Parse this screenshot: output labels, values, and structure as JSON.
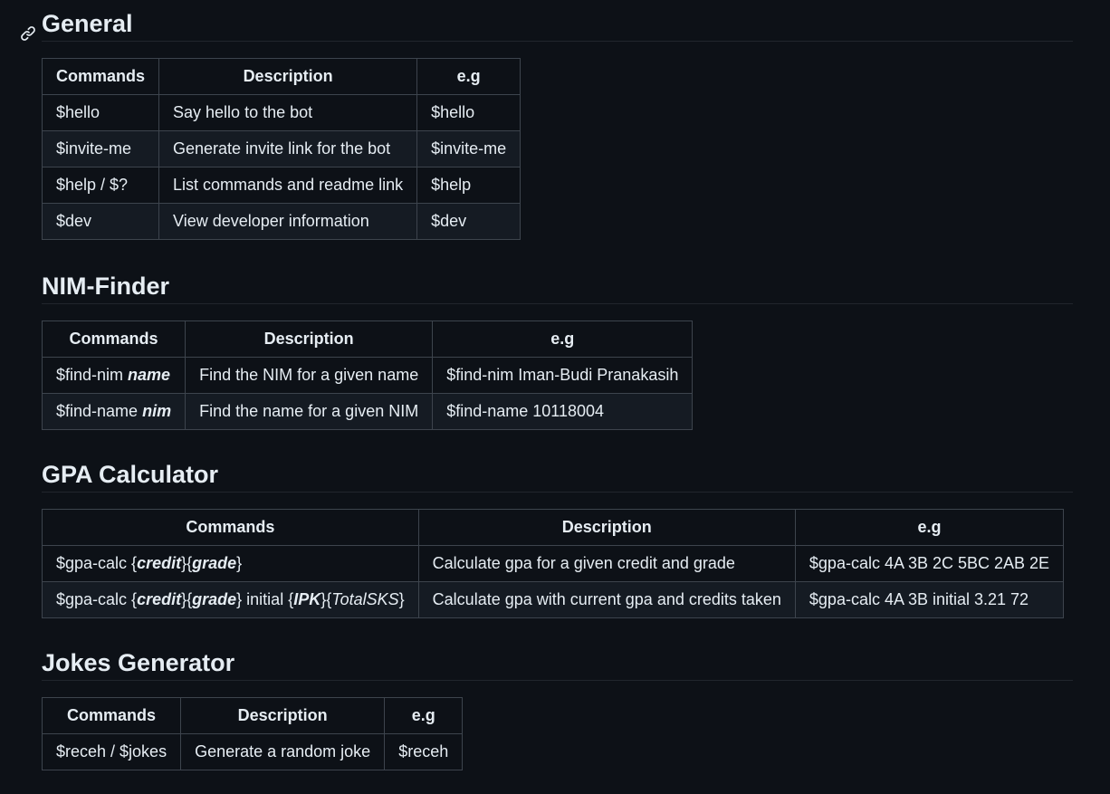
{
  "sections": {
    "general": {
      "title": "General",
      "headers": [
        "Commands",
        "Description",
        "e.g"
      ],
      "rows": [
        {
          "command": "$hello",
          "description": "Say hello to the bot",
          "example": "$hello"
        },
        {
          "command": "$invite-me",
          "description": "Generate invite link for the bot",
          "example": "$invite-me"
        },
        {
          "command": "$help / $?",
          "description": "List commands and readme link",
          "example": "$help"
        },
        {
          "command": "$dev",
          "description": "View developer information",
          "example": "$dev"
        }
      ]
    },
    "nim_finder": {
      "title": "NIM-Finder",
      "headers": [
        "Commands",
        "Description",
        "e.g"
      ],
      "rows": [
        {
          "command_base": "$find-nim",
          "command_arg": "name",
          "description": "Find the NIM for a given name",
          "example": "$find-nim Iman-Budi Pranakasih"
        },
        {
          "command_base": "$find-name",
          "command_arg": "nim",
          "description": "Find the name for a given NIM",
          "example": "$find-name 10118004"
        }
      ]
    },
    "gpa_calculator": {
      "title": "GPA Calculator",
      "headers": [
        "Commands",
        "Description",
        "e.g"
      ],
      "rows": [
        {
          "command_base": "$gpa-calc",
          "arg_credit": "credit",
          "arg_grade": "grade",
          "description": "Calculate gpa for a given credit and grade",
          "example": "$gpa-calc 4A 3B 2C 5BC 2AB 2E"
        },
        {
          "command_base": "$gpa-calc",
          "arg_credit": "credit",
          "arg_grade": "grade",
          "initial_word": "initial",
          "arg_ipk": "IPK",
          "arg_total_sks": "TotalSKS",
          "description": "Calculate gpa with current gpa and credits taken",
          "example": "$gpa-calc 4A 3B initial 3.21 72"
        }
      ]
    },
    "jokes_generator": {
      "title": "Jokes Generator",
      "headers": [
        "Commands",
        "Description",
        "e.g"
      ],
      "rows": [
        {
          "command": "$receh / $jokes",
          "description": "Generate a random joke",
          "example": "$receh"
        }
      ]
    }
  },
  "icons": {
    "anchor": "link-icon"
  },
  "colors": {
    "background": "#0d1117",
    "text": "#e6edf3",
    "border": "#3d444d",
    "row_alt": "#151b23"
  }
}
